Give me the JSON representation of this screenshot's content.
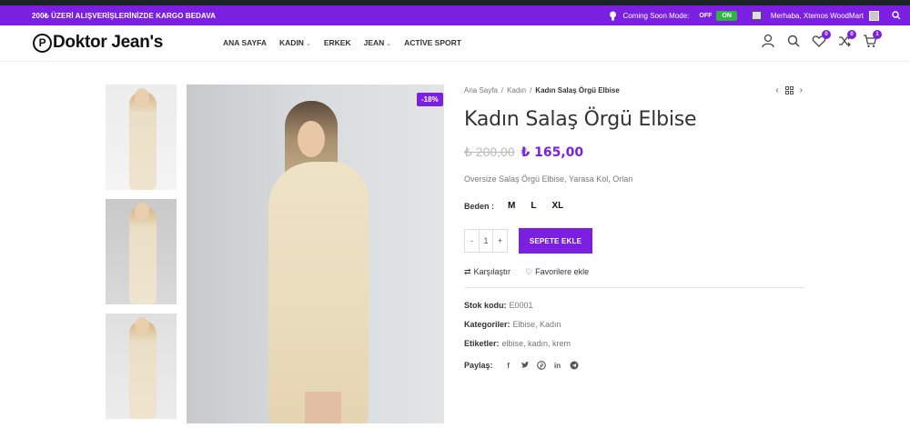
{
  "topbar": {
    "promo": "200₺ ÜZERİ ALIŞVERİŞLERİNİZDE KARGO BEDAVA",
    "coming_soon_label": "Coming Soon Mode:",
    "toggle_off": "OFF",
    "toggle_on": "ON",
    "greeting": "Merhaba, Xtemos WoodMart"
  },
  "header": {
    "logo_text": "Doktor Jean's",
    "logo_mark": "P",
    "nav": [
      {
        "label": "ANA SAYFA"
      },
      {
        "label": "KADIN"
      },
      {
        "label": "ERKEK"
      },
      {
        "label": "JEAN"
      },
      {
        "label": "ACTİVE SPORT"
      }
    ],
    "badges": {
      "wishlist": "0",
      "compare": "0",
      "cart": "1"
    }
  },
  "product": {
    "sale_badge": "-18%",
    "breadcrumb": [
      "Ana Sayfa",
      "Kadın",
      "Kadın Salaş Örgü Elbise"
    ],
    "title": "Kadın Salaş Örgü Elbise",
    "price_old": "₺ 200,00",
    "price_new": "₺ 165,00",
    "short_description": "Oversize Salaş Örgü Elbise, Yarasa Kol, Orlan",
    "size_label": "Beden :",
    "sizes": [
      "M",
      "L",
      "XL"
    ],
    "qty_minus": "-",
    "qty_value": "1",
    "qty_plus": "+",
    "add_to_cart": "SEPETE EKLE",
    "compare_label": "Karşılaştır",
    "wishlist_label": "Favorilere ekle",
    "sku_label": "Stok kodu:",
    "sku_value": "E0001",
    "categories_label": "Kategoriler:",
    "categories_value": "Elbise, Kadın",
    "tags_label": "Etiketler:",
    "tags_value": "elbise, kadın, krem",
    "share_label": "Paylaş:"
  },
  "colors": {
    "accent": "#7b1fe0",
    "toggle_on": "#2fb344"
  }
}
